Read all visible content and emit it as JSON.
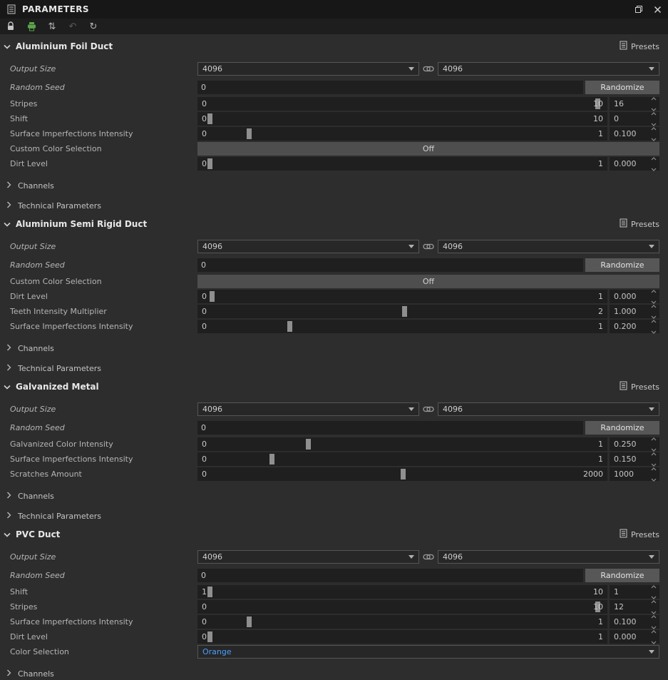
{
  "window": {
    "title": "PARAMETERS"
  },
  "toolbar": {
    "icons": [
      "lock",
      "printer",
      "swap-vertical",
      "revert",
      "history"
    ]
  },
  "colors": {
    "accent_blue": "#4a9eff",
    "toolbar_green": "#5aa349",
    "panel_bg": "#2d2d2d",
    "titlebar_bg": "#171717"
  },
  "sections": [
    {
      "title": "Aluminium Foil Duct",
      "presets_label": "Presets",
      "output_size": {
        "label": "Output Size",
        "width_value": "4096",
        "height_value": "4096"
      },
      "random_seed": {
        "label": "Random Seed",
        "value": "0",
        "button_label": "Randomize"
      },
      "sliders": [
        {
          "label": "Stripes",
          "min": "0",
          "max": "10",
          "value": "16",
          "pos": 0.975
        },
        {
          "label": "Shift",
          "min": "0",
          "max": "10",
          "value": "0",
          "pos": 0.03
        },
        {
          "label": "Surface Imperfections Intensity",
          "min": "0",
          "max": "1",
          "value": "0.100",
          "pos": 0.125
        },
        {
          "label": "Dirt Level",
          "min": "0",
          "max": "1",
          "value": "0.000",
          "pos": 0.03
        }
      ],
      "toggle": {
        "label": "Custom Color Selection",
        "value": "Off"
      },
      "groups": [
        "Channels",
        "Technical Parameters"
      ]
    },
    {
      "title": "Aluminium Semi Rigid Duct",
      "presets_label": "Presets",
      "output_size": {
        "label": "Output Size",
        "width_value": "4096",
        "height_value": "4096"
      },
      "random_seed": {
        "label": "Random Seed",
        "value": "0",
        "button_label": "Randomize"
      },
      "toggle": {
        "label": "Custom Color Selection",
        "value": "Off"
      },
      "sliders": [
        {
          "label": "Dirt Level",
          "min": "0",
          "max": "1",
          "value": "0.000",
          "pos": 0.035
        },
        {
          "label": "Teeth Intensity Multiplier",
          "min": "0",
          "max": "2",
          "value": "1.000",
          "pos": 0.505
        },
        {
          "label": "Surface Imperfections Intensity",
          "min": "0",
          "max": "1",
          "value": "0.200",
          "pos": 0.225
        }
      ],
      "groups": [
        "Channels",
        "Technical Parameters"
      ]
    },
    {
      "title": "Galvanized Metal",
      "presets_label": "Presets",
      "output_size": {
        "label": "Output Size",
        "width_value": "4096",
        "height_value": "4096"
      },
      "random_seed": {
        "label": "Random Seed",
        "value": "0",
        "button_label": "Randomize"
      },
      "sliders": [
        {
          "label": "Galvanized Color Intensity",
          "min": "0",
          "max": "1",
          "value": "0.250",
          "pos": 0.27
        },
        {
          "label": "Surface Imperfections Intensity",
          "min": "0",
          "max": "1",
          "value": "0.150",
          "pos": 0.18
        },
        {
          "label": "Scratches Amount",
          "min": "0",
          "max": "2000",
          "value": "1000",
          "pos": 0.5
        }
      ],
      "groups": [
        "Channels",
        "Technical Parameters"
      ]
    },
    {
      "title": "PVC Duct",
      "presets_label": "Presets",
      "output_size": {
        "label": "Output Size",
        "width_value": "4096",
        "height_value": "4096"
      },
      "random_seed": {
        "label": "Random Seed",
        "value": "0",
        "button_label": "Randomize"
      },
      "sliders": [
        {
          "label": "Shift",
          "min": "1",
          "max": "10",
          "value": "1",
          "pos": 0.03
        },
        {
          "label": "Stripes",
          "min": "0",
          "max": "10",
          "value": "12",
          "pos": 0.975
        },
        {
          "label": "Surface Imperfections Intensity",
          "min": "0",
          "max": "1",
          "value": "0.100",
          "pos": 0.125
        },
        {
          "label": "Dirt Level",
          "min": "0",
          "max": "1",
          "value": "0.000",
          "pos": 0.03
        }
      ],
      "color_selection": {
        "label": "Color Selection",
        "value": "Orange"
      },
      "groups": [
        "Channels"
      ]
    }
  ]
}
